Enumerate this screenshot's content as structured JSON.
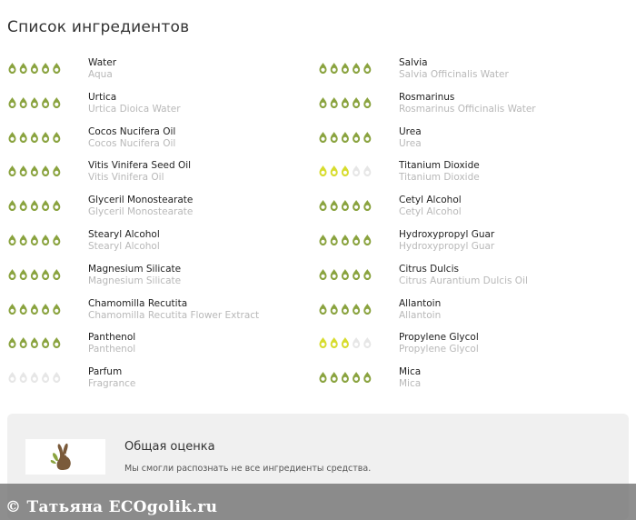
{
  "title": "Список ингредиентов",
  "colors": {
    "good": "#8aa33f",
    "medium": "#d7dc2e",
    "empty": "#e6e6e6",
    "card": "#f0f0f0"
  },
  "ingredients_left": [
    {
      "name": "Water",
      "alt": "Aqua",
      "rating": 5,
      "level": "good"
    },
    {
      "name": "Urtica",
      "alt": "Urtica Dioica Water",
      "rating": 5,
      "level": "good"
    },
    {
      "name": "Cocos Nucifera Oil",
      "alt": "Cocos Nucifera Oil",
      "rating": 5,
      "level": "good"
    },
    {
      "name": "Vitis Vinifera Seed Oil",
      "alt": "Vitis Vinifera Oil",
      "rating": 5,
      "level": "good"
    },
    {
      "name": "Glyceril Monostearate",
      "alt": "Glyceril Monostearate",
      "rating": 5,
      "level": "good"
    },
    {
      "name": "Stearyl Alcohol",
      "alt": "Stearyl Alcohol",
      "rating": 5,
      "level": "good"
    },
    {
      "name": "Magnesium Silicate",
      "alt": "Magnesium Silicate",
      "rating": 5,
      "level": "good"
    },
    {
      "name": "Chamomilla Recutita",
      "alt": "Chamomilla Recutita Flower Extract",
      "rating": 5,
      "level": "good"
    },
    {
      "name": "Panthenol",
      "alt": "Panthenol",
      "rating": 5,
      "level": "good"
    },
    {
      "name": "Parfum",
      "alt": "Fragrance",
      "rating": 0,
      "level": "empty"
    }
  ],
  "ingredients_right": [
    {
      "name": "Salvia",
      "alt": "Salvia Officinalis Water",
      "rating": 5,
      "level": "good"
    },
    {
      "name": "Rosmarinus",
      "alt": "Rosmarinus Officinalis Water",
      "rating": 5,
      "level": "good"
    },
    {
      "name": "Urea",
      "alt": "Urea",
      "rating": 5,
      "level": "good"
    },
    {
      "name": "Titanium Dioxide",
      "alt": "Titanium Dioxide",
      "rating": 3,
      "level": "medium"
    },
    {
      "name": "Cetyl Alcohol",
      "alt": "Cetyl Alcohol",
      "rating": 5,
      "level": "good"
    },
    {
      "name": "Hydroxypropyl Guar",
      "alt": "Hydroxypropyl Guar",
      "rating": 5,
      "level": "good"
    },
    {
      "name": "Citrus Dulcis",
      "alt": "Citrus Aurantium Dulcis Oil",
      "rating": 5,
      "level": "good"
    },
    {
      "name": "Allantoin",
      "alt": "Allantoin",
      "rating": 5,
      "level": "good"
    },
    {
      "name": "Propylene Glycol",
      "alt": "Propylene Glycol",
      "rating": 3,
      "level": "medium"
    },
    {
      "name": "Mica",
      "alt": "Mica",
      "rating": 5,
      "level": "good"
    }
  ],
  "summary": {
    "title": "Общая оценка",
    "text": "Мы смогли распознать не все ингредиенты средства.",
    "logo_icon": "rabbit-icon"
  },
  "watermark": "© Татьяна ECOgolik.ru"
}
